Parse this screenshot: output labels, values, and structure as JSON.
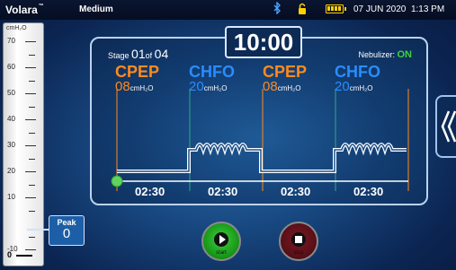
{
  "status": {
    "brand": "Volara",
    "brand_tm": "™",
    "mode": "Medium",
    "date": "07 JUN 2020",
    "time": "1:13 PM",
    "bluetooth_icon": "bluetooth-icon",
    "lock_icon": "lock-icon",
    "battery_icon": "battery-icon"
  },
  "gauge": {
    "unit": "cmH₂O",
    "labels": [
      "70",
      "60",
      "50",
      "40",
      "30",
      "20",
      "10",
      "0",
      "-10"
    ],
    "zero_label": "0",
    "peak_label": "Peak",
    "peak_value": "0"
  },
  "panel": {
    "stage_prefix": "Stage",
    "stage_current": "01",
    "stage_of": "of",
    "stage_total": "04",
    "timer": "10:00",
    "nebulizer_label": "Nebulizer:",
    "nebulizer_value": "ON",
    "phases": [
      {
        "name": "CPEP",
        "pressure": "08",
        "unit": "cmH₂O",
        "duration": "02:30"
      },
      {
        "name": "CHFO",
        "pressure": "20",
        "unit": "cmH₂O",
        "duration": "02:30"
      },
      {
        "name": "CPEP",
        "pressure": "08",
        "unit": "cmH₂O",
        "duration": "02:30"
      },
      {
        "name": "CHFO",
        "pressure": "20",
        "unit": "cmH₂O",
        "duration": "02:30"
      }
    ]
  },
  "buttons": {
    "start": "start",
    "stop": "stop"
  },
  "colors": {
    "cpep": "#ff8a1e",
    "chfo": "#2a8cff",
    "nebulizer_on": "#3ed23e",
    "start": "#1a9b1a",
    "stop": "#5a1018"
  }
}
